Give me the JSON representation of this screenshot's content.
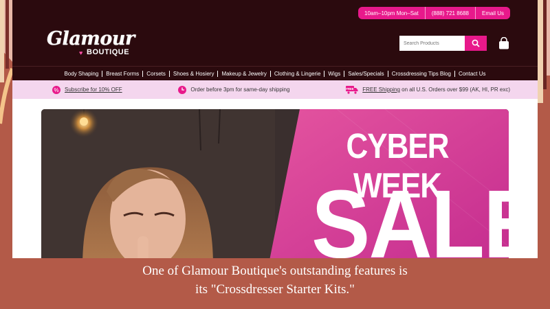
{
  "topbar": {
    "hours": "10am–10pm Mon–Sat",
    "phone": "(888) 721 8688",
    "email_link": "Email Us"
  },
  "header": {
    "logo_main": "Glamour",
    "logo_sub": "BOUTIQUE",
    "search_placeholder": "Search Products",
    "search_icon": "search-icon",
    "cart_icon": "shopping-bag-icon"
  },
  "nav": {
    "items": [
      "Body Shaping",
      "Breast Forms",
      "Corsets",
      "Shoes & Hosiery",
      "Makeup & Jewelry",
      "Clothing & Lingerie",
      "Wigs",
      "Sales/Specials",
      "Crossdressing Tips Blog",
      "Contact Us"
    ]
  },
  "promo": {
    "subscribe": "Subscribe for 10% OFF",
    "shipping_time": "Order before 3pm for same-day shipping",
    "free_badge": "FREE",
    "free_shipping_link": "FREE Shipping",
    "free_shipping_rest": " on all U.S. Orders over $99 (AK, HI, PR exc)"
  },
  "banner": {
    "headline": "CYBER WEEK",
    "sale": "SALE"
  },
  "caption": {
    "line1": "One of Glamour Boutique's outstanding features is",
    "line2": "its \"Crossdresser Starter Kits.\""
  },
  "colors": {
    "brand_pink": "#e8198b",
    "header_bg": "#2b0a0e",
    "promo_bg": "#f4d6ee",
    "slide_bg": "#b35a48"
  }
}
